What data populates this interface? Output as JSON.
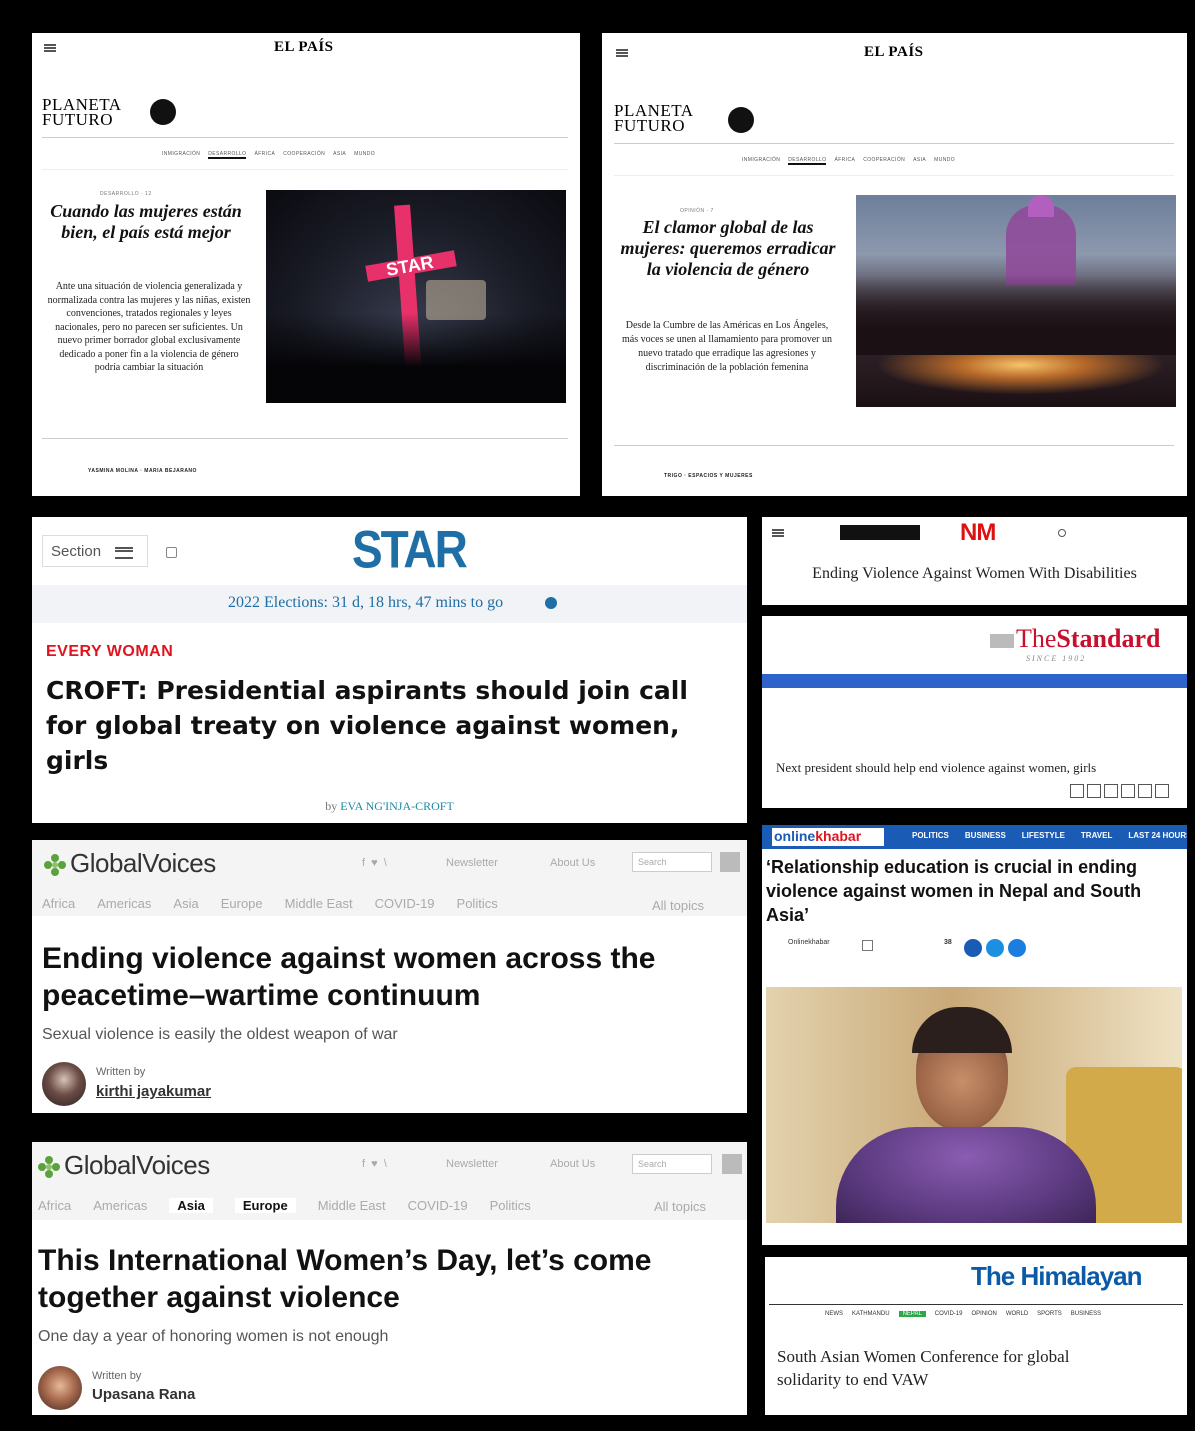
{
  "elpais1": {
    "brand": "EL PAÍS",
    "section_logo": "PLANETA\nFUTURO",
    "nav": [
      "INMIGRACIÓN",
      "DESARROLLO",
      "ÁFRICA",
      "COOPERACIÓN",
      "ASIA",
      "MUNDO"
    ],
    "kicker": "DESARROLLO · 12",
    "headline": "Cuando las mujeres están bien, el país está mejor",
    "deck": "Ante una situación de violencia generalizada y normalizada contra las mujeres y las niñas, existen convenciones, tratados regionales y leyes nacionales, pero no parecen ser suficientes. Un nuevo primer borrador global exclusivamente dedicado a poner fin a la violencia de género podría cambiar la situación",
    "photo_sign": "STAR",
    "authors": "YASMINA MOLINA · MARIA BEJARANO"
  },
  "elpais2": {
    "brand": "EL PAÍS",
    "section_logo": "PLANETA\nFUTURO",
    "nav": [
      "INMIGRACIÓN",
      "DESARROLLO",
      "ÁFRICA",
      "COOPERACIÓN",
      "ASIA",
      "MUNDO"
    ],
    "kicker": "OPINIÓN · 7",
    "headline": "El clamor global de las mujeres: queremos erradicar la violencia de género",
    "deck": "Desde la Cumbre de las Américas en Los Ángeles, más voces se unen al llamamiento para promover un nuevo tratado que erradique las agresiones y discriminación de la población femenina",
    "footer": "TRIGO · ESPACIOS Y MUJERES"
  },
  "star": {
    "section_label": "Section",
    "logo": "STAR",
    "election_text": "2022 Elections: 31 d, 18 hrs, 47 mins to go",
    "kicker": "EVERY WOMAN",
    "headline": "CROFT: Presidential aspirants should join call for global treaty on violence against women, girls",
    "byline_prefix": "by",
    "byline_name": "EVA NG'INJA-CROFT"
  },
  "nm": {
    "logo": "NM",
    "headline": "Ending Violence Against Women With Disabilities"
  },
  "standard": {
    "logo_prefix": "The",
    "logo_main": "Standard",
    "tagline": "SINCE 1902",
    "headline": "Next president should help end violence against women, girls"
  },
  "gv1": {
    "logo_a": "Global",
    "logo_b": "Voices",
    "nav": [
      "Africa",
      "Americas",
      "Asia",
      "Europe",
      "Middle East",
      "COVID-19",
      "Politics"
    ],
    "all_topics": "All topics",
    "newsletter": "Newsletter",
    "about": "About Us",
    "search_placeholder": "Search",
    "headline": "Ending violence against women across the peacetime–wartime continuum",
    "subhead": "Sexual violence is easily the oldest weapon of war",
    "written_by": "Written by",
    "author": "kirthi jayakumar"
  },
  "gv2": {
    "logo_a": "Global",
    "logo_b": "Voices",
    "nav": [
      "Africa",
      "Americas",
      "Asia",
      "Europe",
      "Middle East",
      "COVID-19",
      "Politics"
    ],
    "all_topics": "All topics",
    "newsletter": "Newsletter",
    "about": "About Us",
    "search_placeholder": "Search",
    "headline": "This International Women’s Day, let’s come together against violence",
    "subhead": "One day a year of honoring women is not enough",
    "written_by": "Written by",
    "author": "Upasana Rana"
  },
  "ok": {
    "logo_a": "online",
    "logo_b": "khabar",
    "nav": [
      "POLITICS",
      "BUSINESS",
      "LIFESTYLE",
      "TRAVEL",
      "LAST 24 HOURS"
    ],
    "headline": "‘Relationship education is crucial in ending violence against women in Nepal and South Asia’",
    "source": "Onlinekhabar",
    "shares": "38"
  },
  "himalayan": {
    "logo": "The Himalayan",
    "nav": [
      "NEWS",
      "KATHMANDU",
      "NEPAL",
      "COVID-19",
      "OPINION",
      "WORLD",
      "SPORTS",
      "BUSINESS"
    ],
    "headline": "South Asian Women Conference for global solidarity to end VAW"
  },
  "colors": {
    "star_blue": "#1d6fa5",
    "star_red": "#e0141e",
    "standard_red": "#c8102e",
    "ok_blue": "#1a5bb5",
    "himalayan_blue": "#0a5aa8",
    "gv_green": "#5aa33a"
  }
}
